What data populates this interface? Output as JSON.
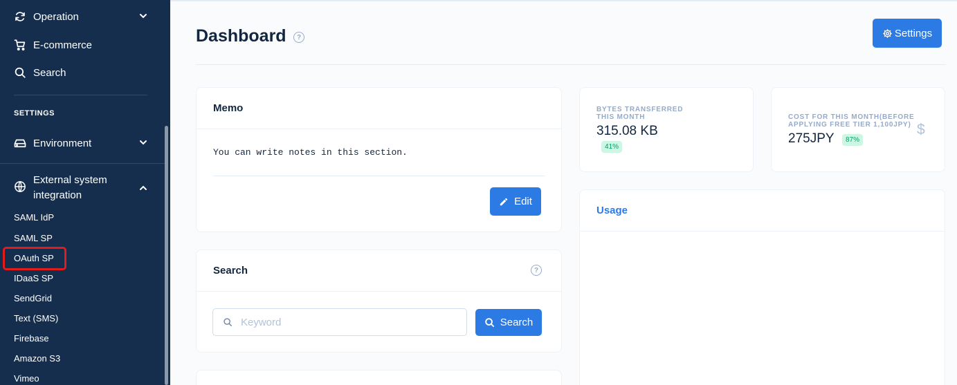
{
  "sidebar": {
    "items": [
      {
        "label": "Operation",
        "icon": "refresh-icon"
      },
      {
        "label": "E-commerce",
        "icon": "cart-icon"
      },
      {
        "label": "Search",
        "icon": "search-icon"
      }
    ],
    "settings_heading": "SETTINGS",
    "environment": {
      "label": "Environment",
      "icon": "hard-drive-icon"
    },
    "external": {
      "label_line1": "External system",
      "label_line2": "integration",
      "icon": "globe-icon"
    },
    "subitems": [
      "SAML IdP",
      "SAML SP",
      "OAuth SP",
      "IDaaS SP",
      "SendGrid",
      "Text (SMS)",
      "Firebase",
      "Amazon S3",
      "Vimeo"
    ],
    "highlighted_subitem": "OAuth SP",
    "highlight_color": "#e31b1b"
  },
  "header": {
    "title": "Dashboard",
    "settings_label": "Settings"
  },
  "memo": {
    "title": "Memo",
    "text": "You can write notes in this section.",
    "edit_label": "Edit"
  },
  "search": {
    "title": "Search",
    "placeholder": "Keyword",
    "button_label": "Search"
  },
  "stats": {
    "bytes": {
      "label_line1": "BYTES TRANSFERRED",
      "label_line2": "THIS MONTH",
      "value": "315.08 KB",
      "badge": "41%"
    },
    "cost": {
      "label_line1": "COST FOR THIS MONTH(BEFORE",
      "label_line2": "APPLYING FREE TIER 1,100JPY)",
      "value": "275JPY",
      "badge": "87%",
      "icon_glyph": "$"
    }
  },
  "usage": {
    "title": "Usage"
  },
  "colors": {
    "sidebar_bg": "#152e4d",
    "primary": "#2c7be5",
    "badge_bg": "#ccf7e5",
    "badge_text": "#00a067"
  }
}
